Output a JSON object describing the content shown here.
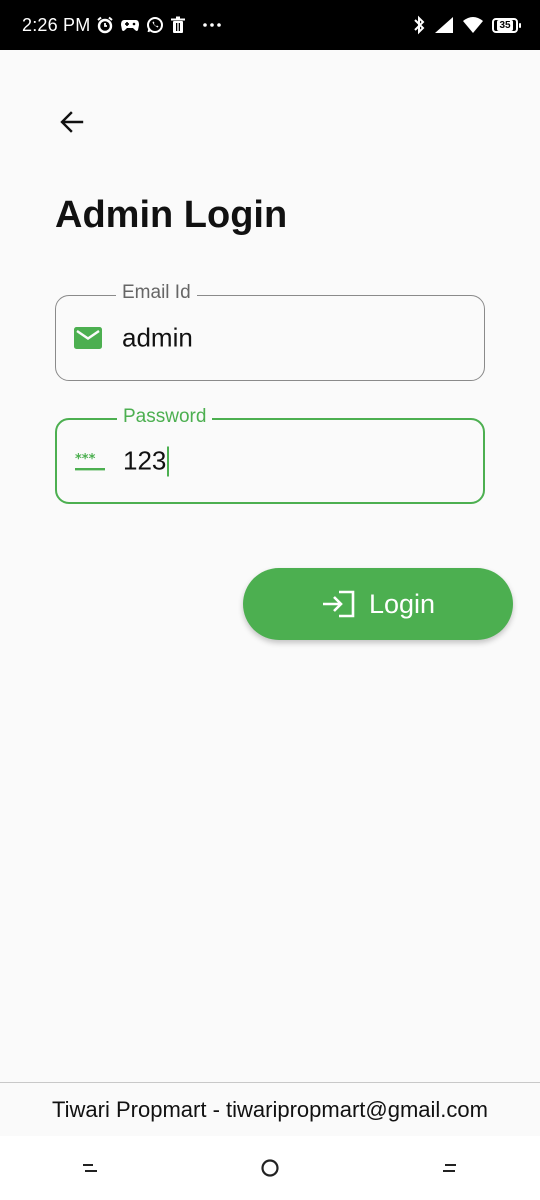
{
  "status_bar": {
    "time": "2:26 PM",
    "battery": "35",
    "left_icons": [
      "alarm-icon",
      "game-controller-icon",
      "whatsapp-icon",
      "trash-icon",
      "more-dots-icon"
    ],
    "right_icons": [
      "bluetooth-icon",
      "cell-signal-icon",
      "wifi-icon",
      "battery-icon"
    ]
  },
  "header": {
    "back_icon": "arrow-back-icon",
    "title": "Admin Login"
  },
  "form": {
    "email": {
      "label": "Email Id",
      "value": "admin",
      "icon": "email-icon"
    },
    "password": {
      "label": "Password",
      "value": "123",
      "icon": "password-icon"
    },
    "login_button": {
      "label": "Login",
      "icon": "login-icon"
    }
  },
  "footer": {
    "text": "Tiwari Propmart - tiwaripropmart@gmail.com"
  },
  "nav_bar": {
    "items": [
      "menu-icon",
      "home-icon",
      "back-icon"
    ]
  },
  "colors": {
    "accent": "#4caf50",
    "background": "#fafafa",
    "status_bar": "#000000"
  }
}
